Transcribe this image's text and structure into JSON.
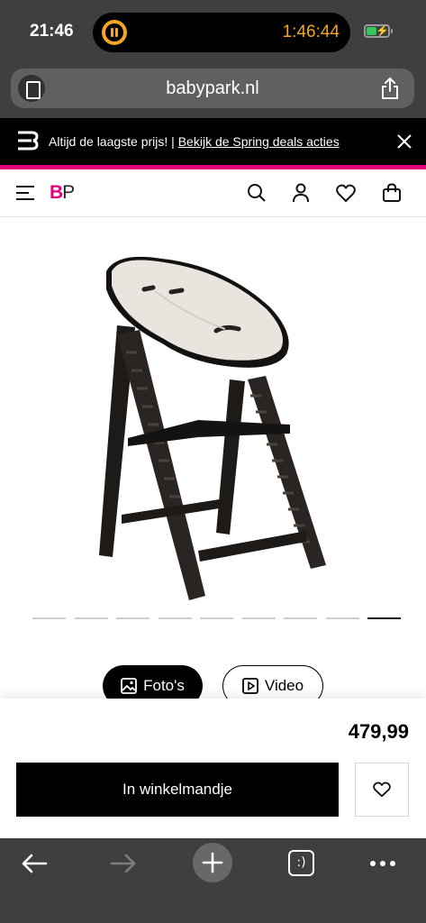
{
  "status_bar": {
    "time": "21:46",
    "timer": "1:46:44",
    "battery_level": 0.4
  },
  "browser": {
    "url": "babypark.nl",
    "icons": [
      "reader-icon",
      "share-icon"
    ]
  },
  "promo": {
    "text": "Altijd de laagste prijs! | ",
    "link": "Bekijk de Spring deals acties"
  },
  "header": {
    "logo_b": "B",
    "logo_p": "P",
    "icons": [
      "menu-icon",
      "search-icon",
      "account-icon",
      "heart-icon",
      "bag-icon"
    ]
  },
  "gallery": {
    "image_count": 9,
    "active_index": 8,
    "photos_label": "Foto's",
    "video_label": "Video"
  },
  "product": {
    "price": "479,99",
    "add_to_cart_label": "In winkelmandje"
  },
  "toolbar": {
    "tabs_label": ":)"
  },
  "colors": {
    "brand_pink": "#e4007d",
    "chrome_gray": "#3d3f41",
    "timer_orange": "#f5a524"
  }
}
